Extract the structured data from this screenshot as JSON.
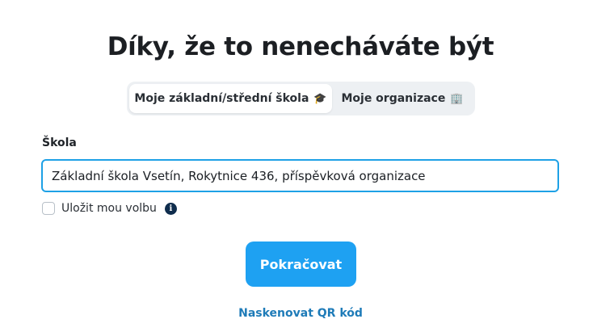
{
  "page": {
    "title": "Díky, že to nenecháváte být"
  },
  "tabs": [
    {
      "label": "Moje základní/střední škola",
      "emoji": "🎓",
      "active": true
    },
    {
      "label": "Moje organizace",
      "emoji": "🏢",
      "active": false
    }
  ],
  "form": {
    "school_label": "Škola",
    "school_value": "Základní škola Vsetín, Rokytnice 436, příspěvková organizace",
    "remember_label": "Uložit mou volbu",
    "remember_checked": false,
    "info_icon": "info-icon"
  },
  "actions": {
    "continue_label": "Pokračovat",
    "qr_link_label": "Naskenovat QR kód"
  },
  "colors": {
    "accent": "#1ea1f2",
    "link": "#1e7bb8",
    "info_icon_bg": "#0f2d4d"
  }
}
